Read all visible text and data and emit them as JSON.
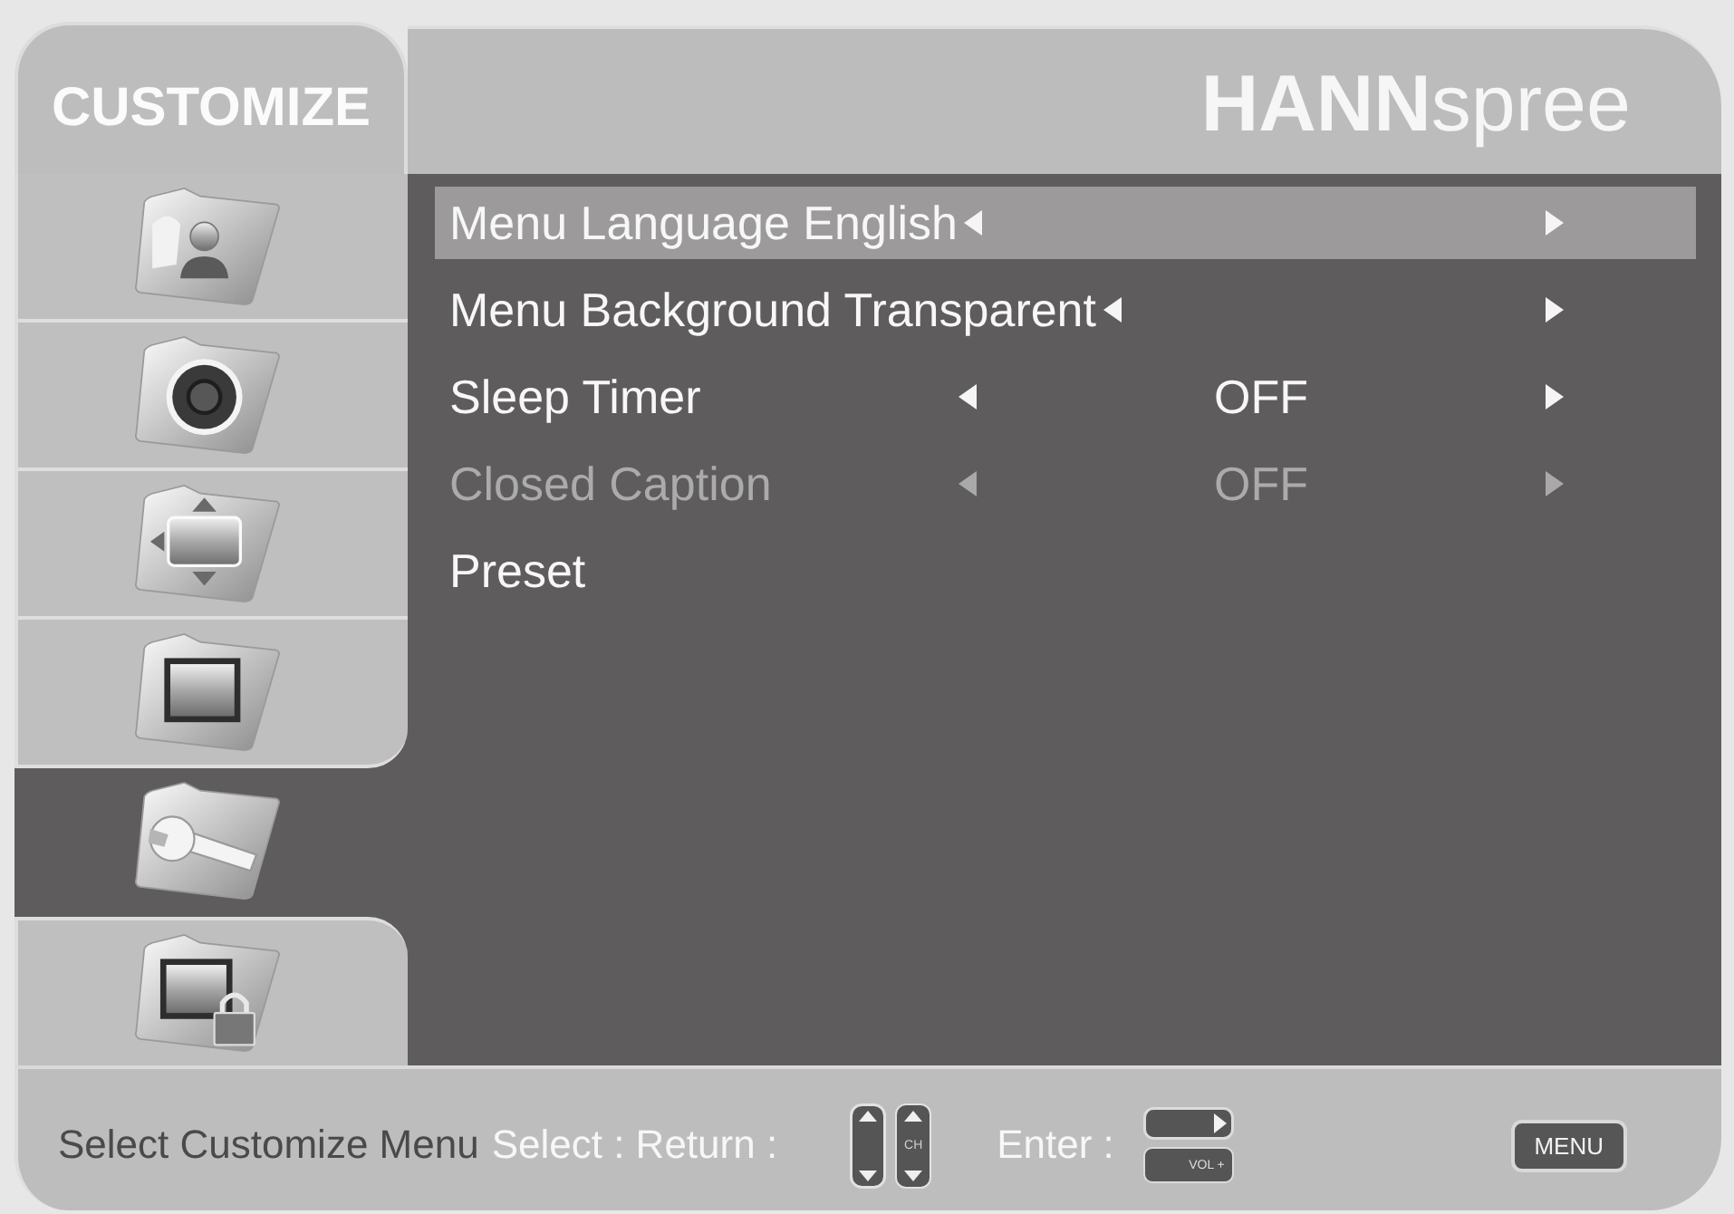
{
  "header": {
    "title": "CUSTOMIZE",
    "logo": "**HANN**spree"
  },
  "sidebar": {
    "items": [
      {
        "kind": "picture",
        "selected": false
      },
      {
        "kind": "sound",
        "selected": false
      },
      {
        "kind": "position",
        "selected": false
      },
      {
        "kind": "display",
        "selected": false
      },
      {
        "kind": "setup",
        "selected": true
      },
      {
        "kind": "lock",
        "selected": false
      }
    ]
  },
  "menu": {
    "items": [
      {
        "kind": "option",
        "label": "Menu Language English",
        "selected": true,
        "disabled": false
      },
      {
        "kind": "option",
        "label": "Menu Background Transparent",
        "selected": false,
        "disabled": false
      },
      {
        "kind": "option",
        "label": "Sleep Timer",
        "value": "OFF",
        "selected": false,
        "disabled": false
      },
      {
        "kind": "option",
        "label": "Closed Caption",
        "value": "OFF",
        "selected": false,
        "disabled": true
      },
      {
        "kind": "action",
        "label": "Preset",
        "selected": false,
        "disabled": false
      }
    ]
  },
  "footer": {
    "description": "Select Customize Menu",
    "select_hint": "Select : Return :",
    "channel_key": "CH",
    "enter_hint": "Enter :",
    "volume_key": "VOL +",
    "menu_key": "MENU"
  }
}
